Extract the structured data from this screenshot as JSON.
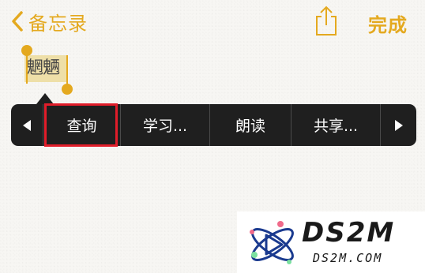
{
  "navbar": {
    "back_label": "备忘录",
    "back_icon": "chevron-left-icon",
    "share_icon": "share-icon",
    "done_label": "完成",
    "accent_color": "#e4a91f"
  },
  "note": {
    "selected_text": "魍魉",
    "selection_color": "#eedfa8"
  },
  "edit_menu": {
    "prev_icon": "triangle-left-icon",
    "items": [
      {
        "label": "查询",
        "highlighted": true
      },
      {
        "label": "学习..."
      },
      {
        "label": "朗读"
      },
      {
        "label": "共享..."
      }
    ],
    "next_icon": "triangle-right-icon",
    "background_color": "#1f1f1f",
    "highlight_color": "#e11d2a"
  },
  "watermark": {
    "title": "DS2M",
    "subtitle": "DS2M.COM"
  }
}
